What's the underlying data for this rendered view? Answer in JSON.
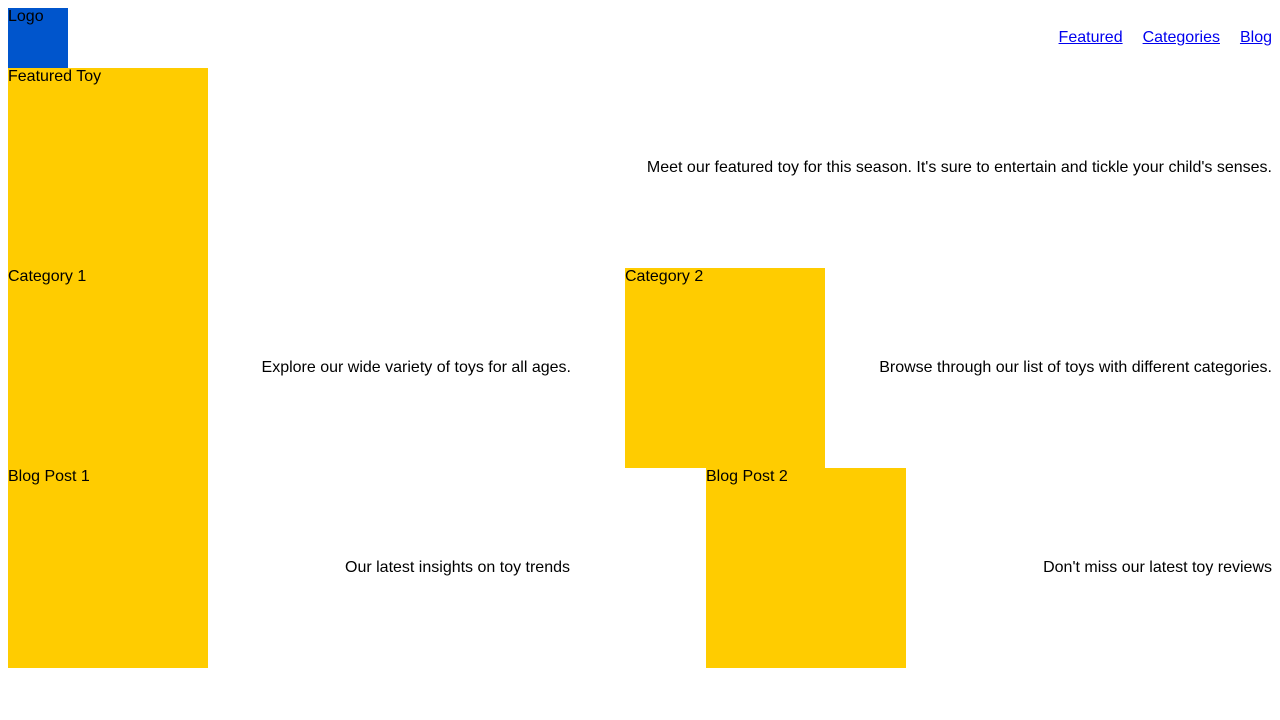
{
  "header": {
    "logo_label": "Logo",
    "nav": {
      "featured": "Featured",
      "categories": "Categories",
      "blog": "Blog"
    }
  },
  "featured": {
    "title": "Featured Toy",
    "description": "Meet our featured toy for this season. It's sure to entertain and tickle your child's senses."
  },
  "categories": [
    {
      "title": "Category 1",
      "description": "Explore our wide variety of toys for all ages."
    },
    {
      "title": "Category 2",
      "description": "Browse through our list of toys with different categories."
    }
  ],
  "blog": [
    {
      "title": "Blog Post 1",
      "description": "Our latest insights on toy trends"
    },
    {
      "title": "Blog Post 2",
      "description": "Don't miss our latest toy reviews"
    }
  ],
  "colors": {
    "logo_background": "#0055cc",
    "card_background": "#ffcc00",
    "link": "#0000ee"
  }
}
